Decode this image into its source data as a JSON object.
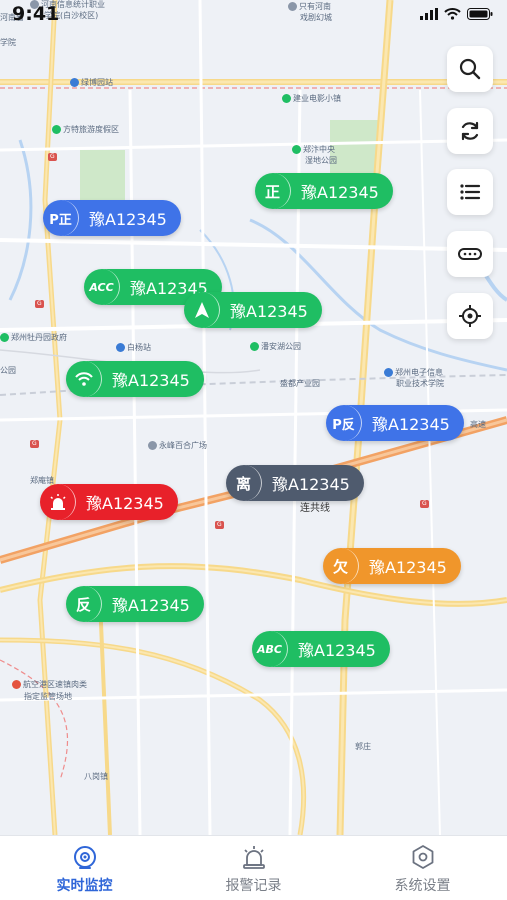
{
  "status_bar": {
    "time": "9:41"
  },
  "map": {
    "labels": [
      {
        "text": "河南信息统计职业",
        "icon": "gray"
      },
      {
        "text": "学院(白沙校区)",
        "icon": ""
      },
      {
        "text": "河南省",
        "icon": ""
      },
      {
        "text": "学院",
        "icon": ""
      },
      {
        "text": "只有河南",
        "icon": "gray"
      },
      {
        "text": "戏剧幻城",
        "icon": ""
      },
      {
        "text": "绿博园站",
        "icon": "blue"
      },
      {
        "text": "建业电影小镇",
        "icon": "green"
      },
      {
        "text": "方特旅游度假区",
        "icon": "green"
      },
      {
        "text": "郑汴中央",
        "icon": "green"
      },
      {
        "text": "湿地公园",
        "icon": ""
      },
      {
        "text": "郑州牡丹园政府",
        "icon": "green"
      },
      {
        "text": "公园",
        "icon": ""
      },
      {
        "text": "白杨站",
        "icon": "blue"
      },
      {
        "text": "潘安湖公园",
        "icon": "green"
      },
      {
        "text": "盛都产业园",
        "icon": ""
      },
      {
        "text": "郑州电子信息",
        "icon": "blue"
      },
      {
        "text": "职业技术学院",
        "icon": ""
      },
      {
        "text": "永峰百合广场",
        "icon": "gray"
      },
      {
        "text": "郑庵镇",
        "icon": ""
      },
      {
        "text": "连共线",
        "icon": ""
      },
      {
        "text": "航空港区速镇肉类",
        "icon": "red"
      },
      {
        "text": "指定监管场地",
        "icon": ""
      },
      {
        "text": "八岗镇",
        "icon": ""
      },
      {
        "text": "郭庄",
        "icon": ""
      },
      {
        "text": "高速",
        "icon": ""
      }
    ]
  },
  "tools": [
    {
      "name": "search-button",
      "icon": "search-icon"
    },
    {
      "name": "refresh-button",
      "icon": "refresh-icon"
    },
    {
      "name": "list-button",
      "icon": "list-icon"
    },
    {
      "name": "more-button",
      "icon": "more-icon"
    },
    {
      "name": "locate-button",
      "icon": "locate-icon"
    }
  ],
  "vehicles": [
    {
      "badge": "正",
      "plate": "豫A12345",
      "color": "#1fbe63"
    },
    {
      "badge": "P正",
      "plate": "豫A12345",
      "color": "#3f73e8"
    },
    {
      "badge": "ACC",
      "plate": "豫A12345",
      "color": "#1fbe63"
    },
    {
      "badge": "",
      "plate": "豫A12345",
      "color": "#1fbe63",
      "icon": "navigation-arrow-icon"
    },
    {
      "badge": "",
      "plate": "豫A12345",
      "color": "#1fbe63",
      "icon": "wifi-signal-icon"
    },
    {
      "badge": "P反",
      "plate": "豫A12345",
      "color": "#3f73e8"
    },
    {
      "badge": "离",
      "plate": "豫A12345",
      "color": "#4f5b6e"
    },
    {
      "badge": "",
      "plate": "豫A12345",
      "color": "#e8212a",
      "icon": "alarm-light-icon"
    },
    {
      "badge": "欠",
      "plate": "豫A12345",
      "color": "#f0962b"
    },
    {
      "badge": "反",
      "plate": "豫A12345",
      "color": "#1fbe63"
    },
    {
      "badge": "ABC",
      "plate": "豫A12345",
      "color": "#1fbe63"
    }
  ],
  "tabbar": {
    "tabs": [
      {
        "label": "实时监控",
        "icon": "monitor-icon",
        "active": true
      },
      {
        "label": "报警记录",
        "icon": "alarm-icon",
        "active": false
      },
      {
        "label": "系统设置",
        "icon": "settings-icon",
        "active": false
      }
    ],
    "active_color": "#2f66d8"
  }
}
